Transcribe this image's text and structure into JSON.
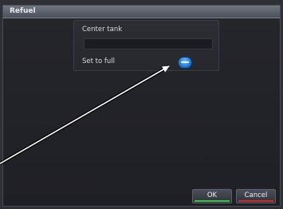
{
  "window": {
    "title": "Refuel"
  },
  "tank": {
    "label": "Center tank",
    "fuel_value": ""
  },
  "set_to_full": {
    "label": "Set to full"
  },
  "buttons": {
    "ok": "OK",
    "cancel": "Cancel"
  },
  "colors": {
    "ok_accent": "#3fc24a",
    "cancel_accent": "#d12a2a",
    "toggle": "#1e6dc7"
  }
}
